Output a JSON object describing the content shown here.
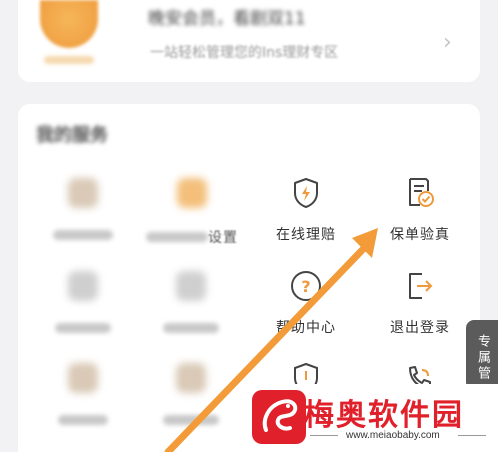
{
  "profile": {
    "greeting": "晚安会员，看剧双11",
    "subtitle": "一站轻松管理您的Ins理财专区",
    "chevron": "›"
  },
  "services": {
    "title": "我的服务",
    "tiles_row1": [
      {
        "label": "",
        "blurred": true
      },
      {
        "label": "",
        "blurred": true,
        "tail": "设置"
      },
      {
        "label": "在线理赔",
        "icon": "shield-lightning-icon"
      },
      {
        "label": "保单验真",
        "icon": "document-check-icon"
      }
    ],
    "tiles_row2": [
      {
        "label": "",
        "blurred": true
      },
      {
        "label": "",
        "blurred": true
      },
      {
        "label": "帮助中心",
        "icon": "help-circle-icon"
      },
      {
        "label": "退出登录",
        "icon": "logout-icon"
      }
    ],
    "tiles_row3": [
      {
        "label": "",
        "blurred": true
      },
      {
        "label": "",
        "blurred": true
      },
      {
        "label": "",
        "icon": "shield-info-icon"
      },
      {
        "label": "",
        "icon": "phone-icon"
      }
    ]
  },
  "side_tab": {
    "label": "专属管"
  },
  "watermark": {
    "title": "梅奥软件园",
    "url": "www.meiaobaby.com"
  },
  "colors": {
    "accent": "#ee9a3c",
    "arrow": "#f29b38",
    "watermark_red": "#e0202a",
    "icon_stroke": "#444444"
  }
}
